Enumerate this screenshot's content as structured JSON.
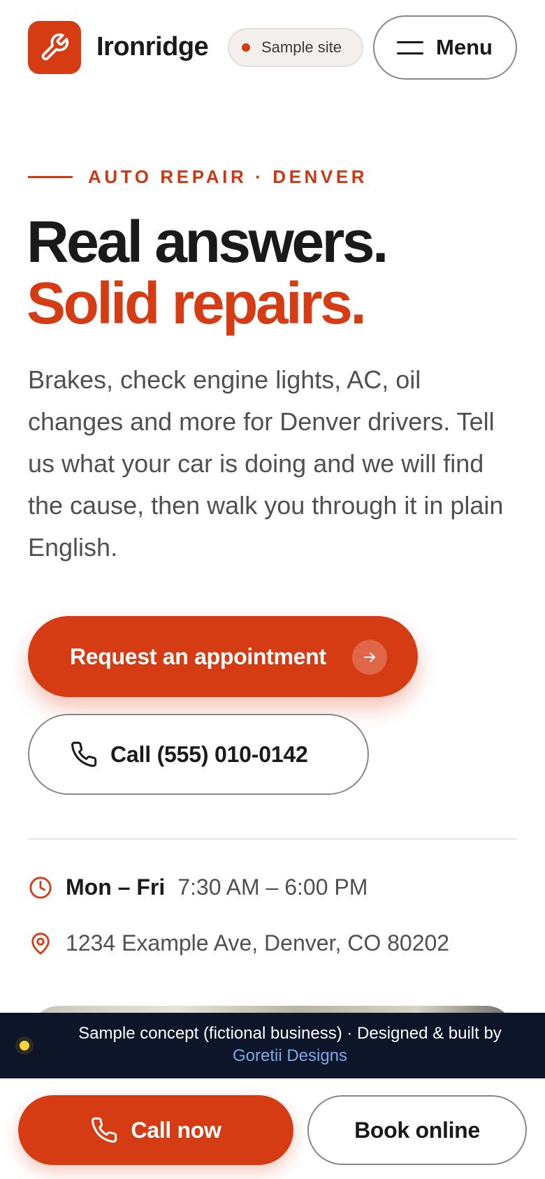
{
  "header": {
    "brand": "Ironridge",
    "badge": "Sample site",
    "menu_label": "Menu",
    "logo_icon": "wrench-icon"
  },
  "hero": {
    "eyebrow": "AUTO REPAIR · DENVER",
    "title_line1": "Real answers.",
    "title_line2": "Solid repairs.",
    "lead": "Brakes, check engine lights, AC, oil changes and more for Denver drivers. Tell us what your car is doing and we will find the cause, then walk you through it in plain English.",
    "primary_cta": "Request an appointment",
    "secondary_cta": "Call (555) 010-0142"
  },
  "info": {
    "hours_days": "Mon – Fri",
    "hours_time": "7:30 AM – 6:00 PM",
    "address": "1234 Example Ave, Denver, CO 80202"
  },
  "banner": {
    "text": "Sample concept (fictional business) · Designed & built by",
    "link": "Goretii Designs"
  },
  "bottom_bar": {
    "call_label": "Call now",
    "book_label": "Book online"
  },
  "colors": {
    "accent": "#d63c14",
    "text": "#1a1a1c",
    "muted": "#505054",
    "banner_bg": "#0d1628",
    "banner_link": "#7fa8e8"
  }
}
